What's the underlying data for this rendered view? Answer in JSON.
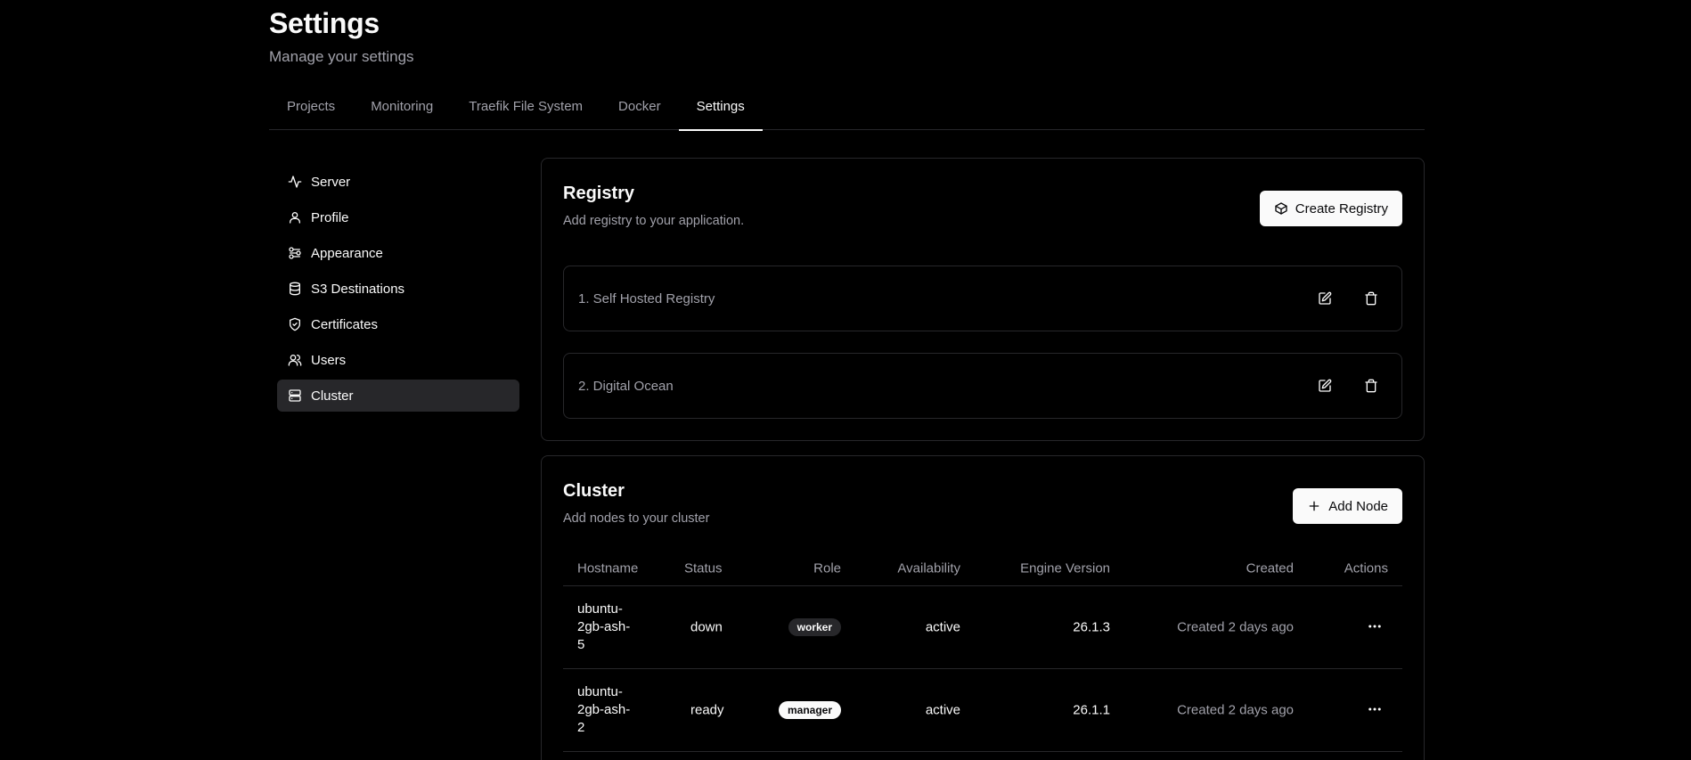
{
  "header": {
    "title": "Settings",
    "subtitle": "Manage your settings"
  },
  "tabs": [
    {
      "label": "Projects",
      "active": false
    },
    {
      "label": "Monitoring",
      "active": false
    },
    {
      "label": "Traefik File System",
      "active": false
    },
    {
      "label": "Docker",
      "active": false
    },
    {
      "label": "Settings",
      "active": true
    }
  ],
  "sidebar": {
    "items": [
      {
        "label": "Server",
        "icon": "activity-icon"
      },
      {
        "label": "Profile",
        "icon": "user-icon"
      },
      {
        "label": "Appearance",
        "icon": "palette-icon"
      },
      {
        "label": "S3 Destinations",
        "icon": "database-icon"
      },
      {
        "label": "Certificates",
        "icon": "shield-check-icon"
      },
      {
        "label": "Users",
        "icon": "users-icon"
      },
      {
        "label": "Cluster",
        "icon": "server-icon",
        "active": true
      }
    ]
  },
  "registry": {
    "title": "Registry",
    "description": "Add registry to your application.",
    "button_label": "Create Registry",
    "items": [
      {
        "label": "1. Self Hosted Registry"
      },
      {
        "label": "2. Digital Ocean"
      }
    ]
  },
  "cluster": {
    "title": "Cluster",
    "description": "Add nodes to your cluster",
    "button_label": "Add Node",
    "columns": {
      "hostname": "Hostname",
      "status": "Status",
      "role": "Role",
      "availability": "Availability",
      "engine": "Engine Version",
      "created": "Created",
      "actions": "Actions"
    },
    "rows": [
      {
        "hostname_lines": [
          "ubuntu-",
          "2gb-ash-",
          "5"
        ],
        "status": "down",
        "role": "worker",
        "availability": "active",
        "engine": "26.1.3",
        "created": "Created 2 days ago"
      },
      {
        "hostname_lines": [
          "ubuntu-",
          "2gb-ash-",
          "2"
        ],
        "status": "ready",
        "role": "manager",
        "availability": "active",
        "engine": "26.1.1",
        "created": "Created 2 days ago"
      }
    ]
  }
}
